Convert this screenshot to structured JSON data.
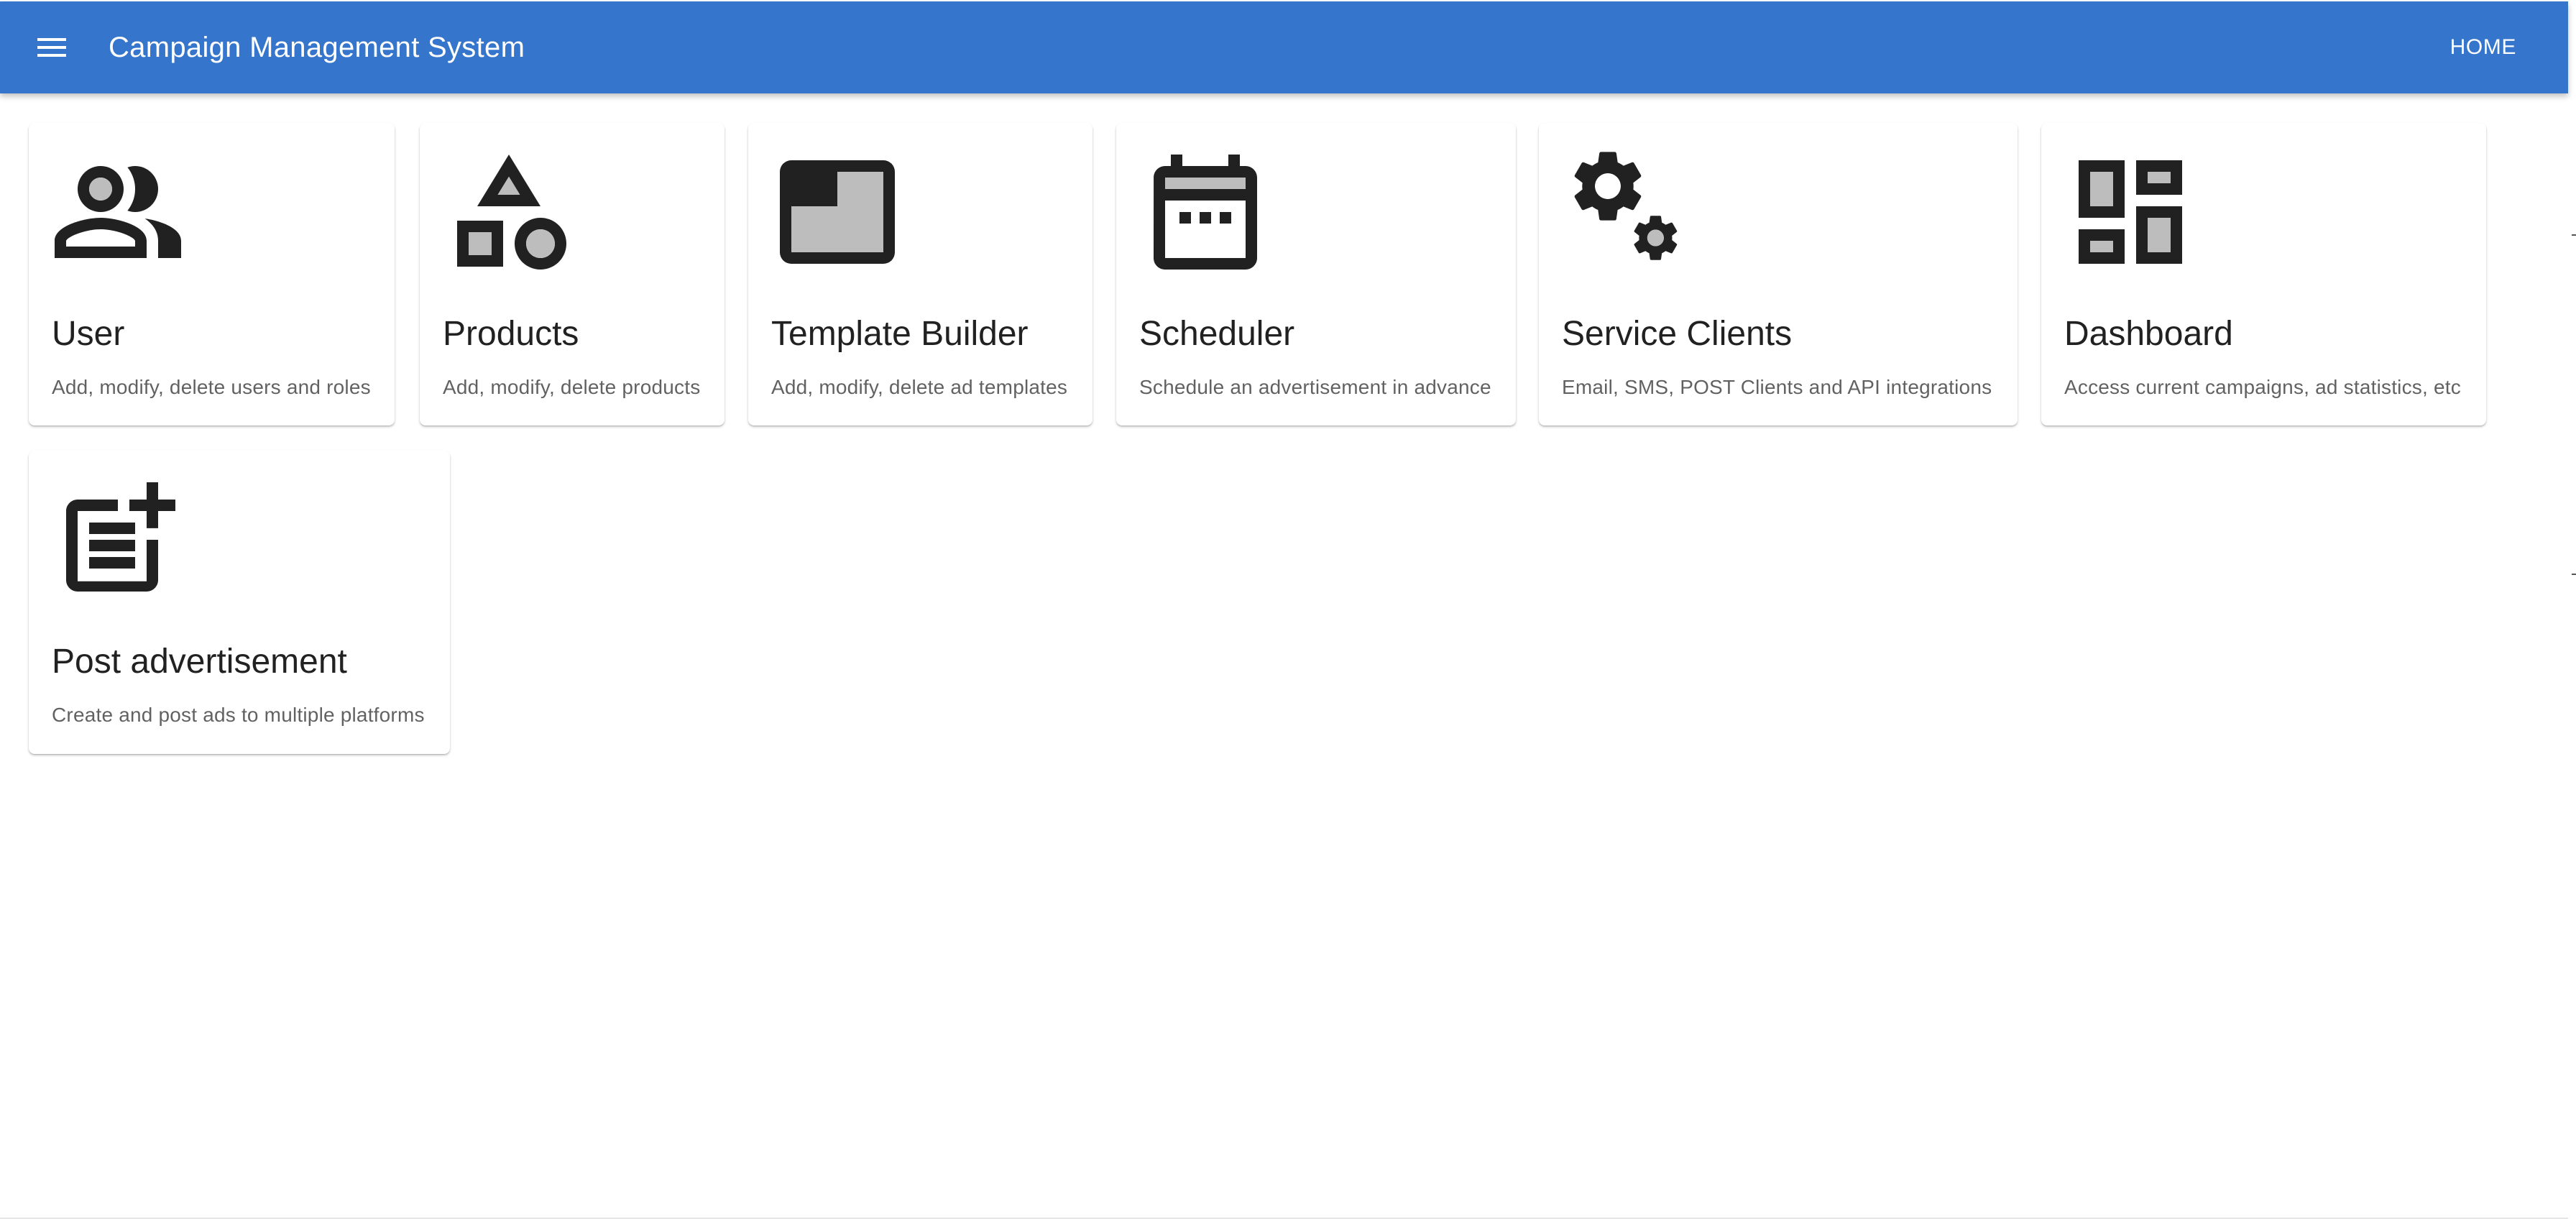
{
  "appbar": {
    "title": "Campaign Management System",
    "home_label": "HOME",
    "color": "#3575cc"
  },
  "cards": [
    {
      "icon": "people-icon",
      "title": "User",
      "description": "Add, modify, delete users and roles"
    },
    {
      "icon": "category-shapes-icon",
      "title": "Products",
      "description": "Add, modify, delete products"
    },
    {
      "icon": "web-asset-icon",
      "title": "Template Builder",
      "description": "Add, modify, delete ad templates"
    },
    {
      "icon": "calendar-icon",
      "title": "Scheduler",
      "description": "Schedule an advertisement in advance"
    },
    {
      "icon": "gears-icon",
      "title": "Service Clients",
      "description": "Email, SMS, POST Clients and API integrations"
    },
    {
      "icon": "dashboard-icon",
      "title": "Dashboard",
      "description": "Access current campaigns, ad statistics, etc"
    },
    {
      "icon": "post-add-icon",
      "title": "Post advertisement",
      "description": "Create and post ads to multiple platforms"
    }
  ]
}
